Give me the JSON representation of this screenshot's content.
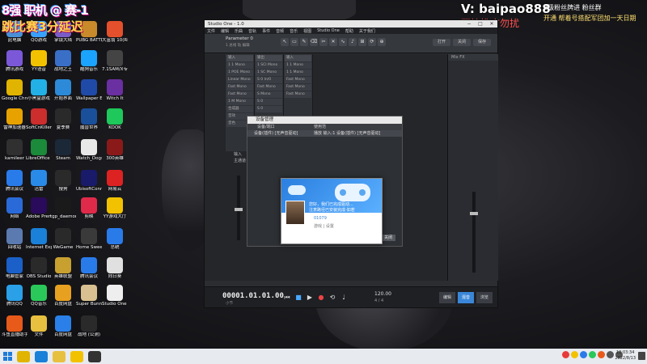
{
  "overlay": {
    "title_line1": "8强 职机 @ 赛-1",
    "title_line2": "跳比赛3分延迟",
    "contact": "V: baipao888",
    "no_ads": "不接推广勿扰",
    "fan_line1": "8级粉丝牌进 粉丝群",
    "fan_line2": "开通 帮着号搭配军团加一天日期"
  },
  "desktop_icons": [
    {
      "label": "此电脑",
      "color": "#4a90d9"
    },
    {
      "label": "QQ游戏",
      "color": "#3aa0ff"
    },
    {
      "label": "掌镜大陆",
      "color": "#7a5cc8"
    },
    {
      "label": "PUBG BATTLEGR...",
      "color": "#c88a2a"
    },
    {
      "label": "大富翁 10(Rich...",
      "color": "#e4502c"
    },
    {
      "label": "腾讯游戏",
      "color": "#7b58d8"
    },
    {
      "label": "YY语音",
      "color": "#f2c200"
    },
    {
      "label": "战地之王",
      "color": "#3a6fc8"
    },
    {
      "label": "酷狗音乐",
      "color": "#1aa3ff"
    },
    {
      "label": "7.1SAM/X专",
      "color": "#444"
    },
    {
      "label": "Google Chrome",
      "color": "#e0b400"
    },
    {
      "label": "小黑盒游戏",
      "color": "#22b0e6"
    },
    {
      "label": "开始界面",
      "color": "#2c8ad8"
    },
    {
      "label": "Wallpaper Engine",
      "color": "#1f4aa8"
    },
    {
      "label": "Witch It",
      "color": "#6a2fa0"
    },
    {
      "label": "雷神加速器",
      "color": "#e8a200"
    },
    {
      "label": "SoftCnKiller",
      "color": "#cc2d2d"
    },
    {
      "label": "夏季赛",
      "color": "#2a2a2a"
    },
    {
      "label": "魔兽世界",
      "color": "#1a4f9a"
    },
    {
      "label": "KOOK",
      "color": "#1ec85a"
    },
    {
      "label": "kamileer",
      "color": "#303030"
    },
    {
      "label": "LibreOffice 7.0",
      "color": "#1b8a3a"
    },
    {
      "label": "Steam",
      "color": "#1b2838"
    },
    {
      "label": "Watch_Dogs 2",
      "color": "#e8e8e8"
    },
    {
      "label": "300英雄",
      "color": "#8a1a1a"
    },
    {
      "label": "腾讯会议",
      "color": "#2a7bea"
    },
    {
      "label": "迅雷",
      "color": "#2a8ae8"
    },
    {
      "label": "搜狗",
      "color": "#2a2a2a"
    },
    {
      "label": "UbisoftConnect",
      "color": "#1a1a6a"
    },
    {
      "label": "网易云",
      "color": "#d22"
    },
    {
      "label": "网络",
      "color": "#2a6ad8"
    },
    {
      "label": "Adobe Premie...",
      "color": "#2a0a5a"
    },
    {
      "label": "tgp_daemon",
      "color": "#1a1a1a"
    },
    {
      "label": "剪映",
      "color": "#e02a4a"
    },
    {
      "label": "YY游戏大厅",
      "color": "#f2c200"
    },
    {
      "label": "回收站",
      "color": "#5a7ab0"
    },
    {
      "label": "Internet Explorer",
      "color": "#1a80d8"
    },
    {
      "label": "WeGame",
      "color": "#2a2a2a"
    },
    {
      "label": "Home Sweet",
      "color": "#3a3a3a"
    },
    {
      "label": "总统",
      "color": "#2a7bea"
    },
    {
      "label": "电脑管家",
      "color": "#1a60c8"
    },
    {
      "label": "OBS Studio",
      "color": "#2a2a2a"
    },
    {
      "label": "英雄联盟",
      "color": "#c8a030"
    },
    {
      "label": "腾讯会议",
      "color": "#2a7bea"
    },
    {
      "label": "向日葵",
      "color": "#e0e0e0"
    },
    {
      "label": "腾讯QQ",
      "color": "#2aa0e8"
    },
    {
      "label": "QQ音乐",
      "color": "#2ac85a"
    },
    {
      "label": "百度网盘",
      "color": "#e8a020"
    },
    {
      "label": "Super Bunny Man",
      "color": "#d8c090"
    },
    {
      "label": "Studio One V3.5",
      "color": "#eeeeee"
    },
    {
      "label": "斗鱼直播助手",
      "color": "#e85a1a"
    },
    {
      "label": "文件",
      "color": "#e8c040"
    },
    {
      "label": "百度网盘",
      "color": "#2a80e8"
    },
    {
      "label": "战地 (公测)",
      "color": "#2a2a2a"
    }
  ],
  "window": {
    "title": "Studio One - 1.0",
    "menu": [
      "文件",
      "编辑",
      "乐曲",
      "音轨",
      "事件",
      "音频",
      "音乐",
      "视图",
      "Studio One",
      "帮助",
      "关于我们"
    ],
    "song_title": "Parameter 0",
    "song_sub": "1 总线 轨 编辑",
    "right_buttons": [
      "打开",
      "关闭",
      "保存"
    ],
    "right_panel_head": "Mix FX",
    "tracks": [
      {
        "head": "输入",
        "items": [
          "1 1 Mono",
          "1 POE Mono",
          "Linear Mono",
          "Fast Mono",
          "Fast Mono",
          "1 M Mono",
          "合成器",
          "音效",
          "音色"
        ]
      },
      {
        "head": "输出",
        "items": [
          "1 SCI Mono",
          "1 SC Mono",
          "S 0 In/0",
          "Fast Mono",
          "S Mono",
          "S 0",
          "S 0"
        ]
      },
      {
        "head": "输入",
        "items": [
          "1 1 Mono",
          "1 1 Mono",
          "Fast Mono",
          "Fast Mono",
          "Fast Mono"
        ]
      }
    ],
    "input_label": "输入",
    "master_label": "主通道",
    "time_display": "00001.01.01.00",
    "bars_label": "小节",
    "tempo": "120.00",
    "time_sig": "4 / 4",
    "bottom_tabs": [
      "编辑",
      "混音",
      "浏览"
    ]
  },
  "dialog": {
    "title": "设备管理",
    "col_device": "设备/端口",
    "col_usage": "使用范",
    "row_device": "设备(插件) [无声音驱动]",
    "row_usage": "播放  输入:1 设备(插件) [无声音驱动]",
    "button": "关闭"
  },
  "popup": {
    "line1": "您好，我们已完成驱动...",
    "line2": "注意路径已安装完成-如若",
    "user_id": "01079",
    "action": "游戏 | 设置"
  },
  "taskbar": {
    "apps": [
      {
        "name": "chrome",
        "color": "#e0b400"
      },
      {
        "name": "ie",
        "color": "#1a80d8"
      },
      {
        "name": "explorer",
        "color": "#e8c040"
      },
      {
        "name": "yy",
        "color": "#f2c200"
      },
      {
        "name": "studio-one",
        "color": "#333"
      }
    ],
    "clock_time": "12:03:34",
    "clock_date": "2022/8/13"
  }
}
